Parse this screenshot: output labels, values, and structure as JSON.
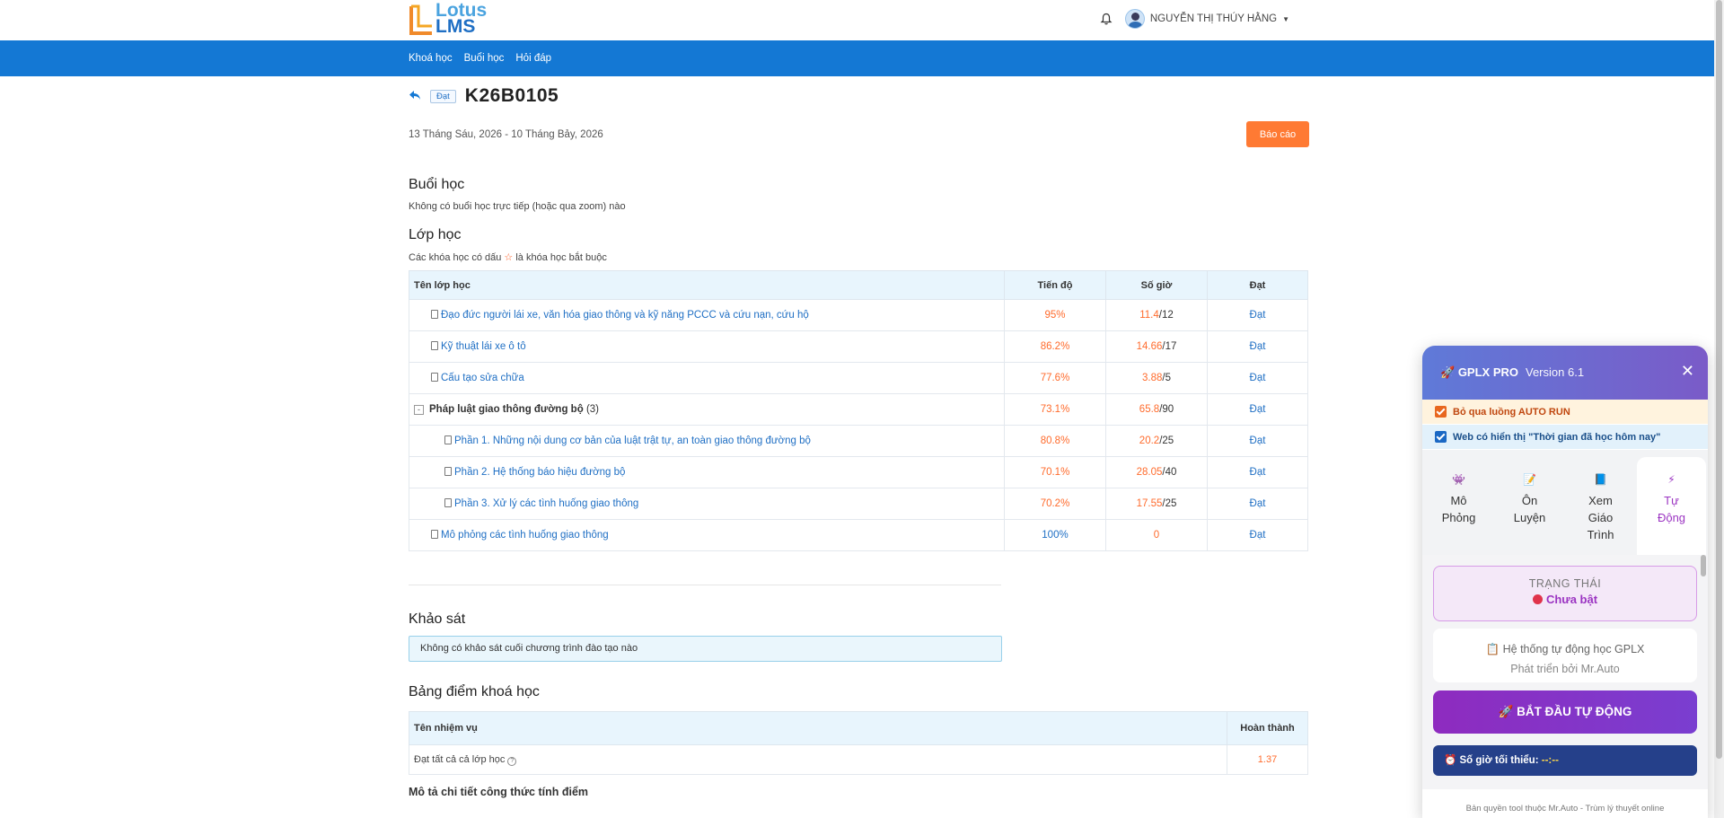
{
  "header": {
    "logo_line1": "Lotus",
    "logo_line2": "LMS",
    "user_name": "NGUYỄN THỊ THÚY HẰNG"
  },
  "nav": {
    "items": [
      "Khoá học",
      "Buổi học",
      "Hỏi đáp"
    ]
  },
  "course": {
    "status_tag": "Đạt",
    "code": "K26B0105",
    "date_range": "13 Tháng Sáu, 2026 - 10 Tháng Bảy, 2026",
    "report_button": "Báo cáo"
  },
  "sessions": {
    "title": "Buổi học",
    "empty_text": "Không có buổi học trực tiếp (hoặc qua zoom) nào"
  },
  "classes": {
    "title": "Lớp học",
    "note_before": "Các khóa học có dấu",
    "note_star": "☆",
    "note_after": "là khóa học bắt buộc",
    "columns": [
      "Tên lớp học",
      "Tiến độ",
      "Số giờ",
      "Đạt"
    ],
    "rows": [
      {
        "name": "Đạo đức người lái xe, văn hóa giao thông và kỹ năng PCCC và cứu nạn, cứu hộ",
        "progress": "95%",
        "hours_done": "11.4",
        "hours_total": "/12",
        "status": "Đạt"
      },
      {
        "name": "Kỹ thuật lái xe ô tô",
        "progress": "86.2%",
        "hours_done": "14.66",
        "hours_total": "/17",
        "status": "Đạt"
      },
      {
        "name": "Cấu tạo sửa chữa",
        "progress": "77.6%",
        "hours_done": "3.88",
        "hours_total": "/5",
        "status": "Đạt"
      },
      {
        "name": "Pháp luật giao thông đường bộ",
        "count": "(3)",
        "progress": "73.1%",
        "hours_done": "65.8",
        "hours_total": "/90",
        "status": "Đạt"
      },
      {
        "name": "Phần 1. Những nội dung cơ bản của luật trật tự, an toàn giao thông đường bộ",
        "progress": "80.8%",
        "hours_done": "20.2",
        "hours_total": "/25",
        "status": "Đạt"
      },
      {
        "name": "Phần 2. Hệ thống báo hiệu đường bộ",
        "progress": "70.1%",
        "hours_done": "28.05",
        "hours_total": "/40",
        "status": "Đạt"
      },
      {
        "name": "Phần 3. Xử lý các tình huống giao thông",
        "progress": "70.2%",
        "hours_done": "17.55",
        "hours_total": "/25",
        "status": "Đạt"
      },
      {
        "name": "Mô phỏng các tình huống giao thông",
        "progress": "100%",
        "hours_done": "0",
        "hours_total": "",
        "status": "Đạt"
      }
    ]
  },
  "survey": {
    "title": "Khảo sát",
    "empty_text": "Không có khảo sát cuối chương trình đào tạo nào"
  },
  "scores": {
    "title": "Bảng điểm khoá học",
    "columns": [
      "Tên nhiệm vụ",
      "Hoàn thành"
    ],
    "rows": [
      {
        "task": "Đạt tất cả cả lớp học",
        "value": "1.37"
      }
    ],
    "formula_title": "Mô tả chi tiết công thức tính điểm"
  },
  "panel": {
    "title": "GPLX PRO",
    "version": "Version 6.1",
    "option1": "Bỏ qua luồng AUTO RUN",
    "option2": "Web có hiển thị \"Thời gian đã học hôm nay\"",
    "tabs": [
      {
        "icon": "👾",
        "label": "Mô Phỏng"
      },
      {
        "icon": "📝",
        "label": "Ôn Luyện"
      },
      {
        "icon": "📘",
        "label": "Xem Giáo Trình"
      },
      {
        "icon": "⚡",
        "label": "Tự Động"
      }
    ],
    "active_tab": "Tự Động",
    "state_label": "TRẠNG THÁI",
    "state_value": "Chưa bật",
    "info_line1": "📋 Hệ thống tự động học GPLX",
    "info_line2": "Phát triển bởi Mr.Auto",
    "start_button": "🚀  BẮT ĐẦU TỰ ĐỘNG",
    "min_hours_label": "⏰ Số giờ tối thiểu:",
    "min_hours_value": "--:--",
    "footer": "Bản quyền tool thuộc Mr.Auto - Trùm lý thuyết online",
    "accent_color": "#9b34c2"
  }
}
